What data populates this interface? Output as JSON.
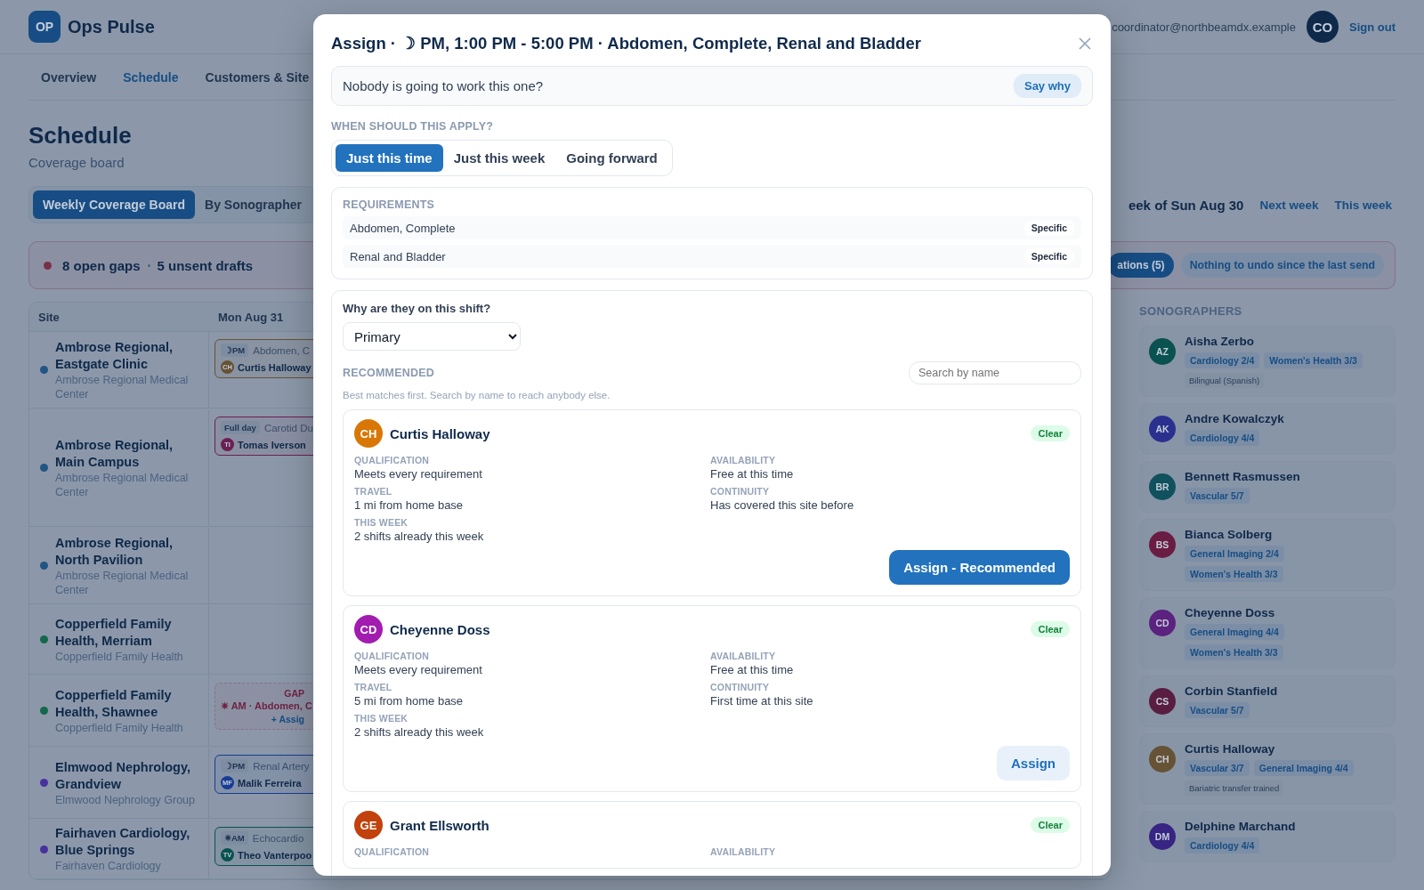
{
  "app": {
    "logo": "OP",
    "name": "Ops Pulse",
    "user_email": "coordinator@northbeamdx.example",
    "user_initials": "CO",
    "sign_out": "Sign out"
  },
  "nav": [
    {
      "label": "Overview",
      "selected": false
    },
    {
      "label": "Schedule",
      "selected": true
    },
    {
      "label": "Customers & Site",
      "selected": false
    }
  ],
  "page": {
    "title": "Schedule",
    "subtitle": "Coverage board"
  },
  "view_tabs": [
    {
      "label": "Weekly Coverage Board",
      "selected": true
    },
    {
      "label": "By Sonographer",
      "selected": false
    }
  ],
  "week": {
    "label": "eek of Sun Aug 30",
    "links": [
      "Next week",
      "This week"
    ]
  },
  "alert": {
    "gaps": "8 open gaps",
    "drafts": "5 unsent drafts",
    "actions": [
      {
        "label": "ations (5)",
        "kind": "primary"
      },
      {
        "label": "Nothing to undo since the last send",
        "kind": "secondary"
      }
    ]
  },
  "board": {
    "columns": [
      "Site",
      "Mon Aug 31"
    ],
    "rows": [
      {
        "site": "Ambrose Regional, Eastgate Clinic",
        "customer": "Ambrose Regional Medical Center",
        "color": "#205584",
        "shifts": [
          {
            "kind": "assigned",
            "session": "☽PM",
            "exam": "Abdomen, C",
            "initials": "CH",
            "person": "Curtis Halloway",
            "color": "#665234"
          }
        ]
      },
      {
        "site": "Ambrose Regional, Main Campus",
        "customer": "Ambrose Regional Medical Center",
        "color": "#205584",
        "shifts": [
          {
            "kind": "assigned",
            "session": "Full day",
            "exam": "Carotid Du",
            "initials": "TI",
            "person": "Tomas Iverson",
            "color": "#6a2054"
          }
        ]
      },
      {
        "site": "Ambrose Regional, North Pavilion",
        "customer": "Ambrose Regional Medical Center",
        "color": "#205584",
        "shifts": []
      },
      {
        "site": "Copperfield Family Health, Merriam",
        "customer": "Copperfield Family Health",
        "color": "#13684a",
        "shifts": []
      },
      {
        "site": "Copperfield Family Health, Shawnee",
        "customer": "Copperfield Family Health",
        "color": "#13684a",
        "shifts": [
          {
            "kind": "gap",
            "label": "GAP",
            "detail": "✷ AM · Abdomen, C",
            "action": "+ Assig"
          }
        ]
      },
      {
        "site": "Elmwood Nephrology, Grandview",
        "customer": "Elmwood Nephrology Group",
        "color": "#48319f",
        "shifts": [
          {
            "kind": "assigned",
            "session": "☽PM",
            "exam": "Renal Artery",
            "initials": "MF",
            "person": "Malik Ferreira",
            "color": "#163c94"
          }
        ]
      },
      {
        "site": "Fairhaven Cardiology, Blue Springs",
        "customer": "Fairhaven Cardiology",
        "color": "#48319f",
        "shifts": [
          {
            "kind": "assigned",
            "session": "✷AM",
            "exam": "Echocardio",
            "initials": "TV",
            "person": "Theo Vanterpoo",
            "color": "#095251"
          }
        ]
      }
    ]
  },
  "sonographers": {
    "title": "SONOGRAPHERS",
    "items": [
      {
        "initials": "AZ",
        "name": "Aisha Zerbo",
        "color": "#095251",
        "tags": [
          "Cardiology 2/4",
          "Women's Health 3/3"
        ],
        "notes": [
          "Bilingual (Spanish)"
        ]
      },
      {
        "initials": "AK",
        "name": "Andre Kowalczyk",
        "color": "#2a308d",
        "tags": [
          "Cardiology 4/4"
        ]
      },
      {
        "initials": "BR",
        "name": "Bennett Rasmussen",
        "color": "#0f515d",
        "tags": [
          "Vascular 5/7"
        ]
      },
      {
        "initials": "BS",
        "name": "Bianca Solberg",
        "color": "#6a1d43",
        "tags": [
          "General Imaging 2/4",
          "Women's Health 3/3"
        ]
      },
      {
        "initials": "CD",
        "name": "Cheyenne Doss",
        "color": "#5b227f",
        "tags": [
          "General Imaging 4/4",
          "Women's Health 3/3"
        ]
      },
      {
        "initials": "CS",
        "name": "Corbin Stanfield",
        "color": "#5a1d42",
        "tags": [
          "Vascular 5/7"
        ]
      },
      {
        "initials": "CH",
        "name": "Curtis Halloway",
        "color": "#665234",
        "tags": [
          "Vascular 3/7",
          "General Imaging 4/4"
        ],
        "notes": [
          "Bariatric transfer trained"
        ]
      },
      {
        "initials": "DM",
        "name": "Delphine Marchand",
        "color": "#372483",
        "tags": [
          "Cardiology 4/4"
        ]
      }
    ]
  },
  "modal": {
    "title": "Assign · ☽ PM, 1:00 PM - 5:00 PM · Abdomen, Complete, Renal and Bladder",
    "unassign": {
      "prompt": "Nobody is going to work this one?",
      "button": "Say why"
    },
    "scope_label": "WHEN SHOULD THIS APPLY?",
    "scope_options": [
      {
        "label": "Just this time",
        "selected": true
      },
      {
        "label": "Just this week",
        "selected": false
      },
      {
        "label": "Going forward",
        "selected": false
      }
    ],
    "requirements": {
      "title": "REQUIREMENTS",
      "items": [
        {
          "name": "Abdomen, Complete",
          "tag": "Specific"
        },
        {
          "name": "Renal and Bladder",
          "tag": "Specific"
        }
      ]
    },
    "reason": {
      "label": "Why are they on this shift?",
      "value": "Primary"
    },
    "recommended": {
      "title": "RECOMMENDED",
      "search": {
        "placeholder": "Search by name"
      },
      "hint": "Best matches first. Search by name to reach anybody else.",
      "candidates": [
        {
          "initials": "CH",
          "name": "Curtis Halloway",
          "color": "#d97706",
          "status": "Clear",
          "fields": [
            {
              "label": "QUALIFICATION",
              "value": "Meets every requirement"
            },
            {
              "label": "AVAILABILITY",
              "value": "Free at this time"
            },
            {
              "label": "TRAVEL",
              "value": "1 mi from home base"
            },
            {
              "label": "CONTINUITY",
              "value": "Has covered this site before"
            },
            {
              "label": "THIS WEEK",
              "value": "2 shifts already this week"
            }
          ],
          "button": {
            "label": "Assign - Recommended",
            "kind": "primary"
          }
        },
        {
          "initials": "CD",
          "name": "Cheyenne Doss",
          "color": "#a21caf",
          "status": "Clear",
          "fields": [
            {
              "label": "QUALIFICATION",
              "value": "Meets every requirement"
            },
            {
              "label": "AVAILABILITY",
              "value": "Free at this time"
            },
            {
              "label": "TRAVEL",
              "value": "5 mi from home base"
            },
            {
              "label": "CONTINUITY",
              "value": "First time at this site"
            },
            {
              "label": "THIS WEEK",
              "value": "2 shifts already this week"
            }
          ],
          "button": {
            "label": "Assign",
            "kind": "secondary"
          }
        },
        {
          "initials": "GE",
          "name": "Grant Ellsworth",
          "color": "#c2410c",
          "status": "Clear",
          "fields": [
            {
              "label": "QUALIFICATION"
            },
            {
              "label": "AVAILABILITY"
            }
          ]
        }
      ]
    }
  }
}
